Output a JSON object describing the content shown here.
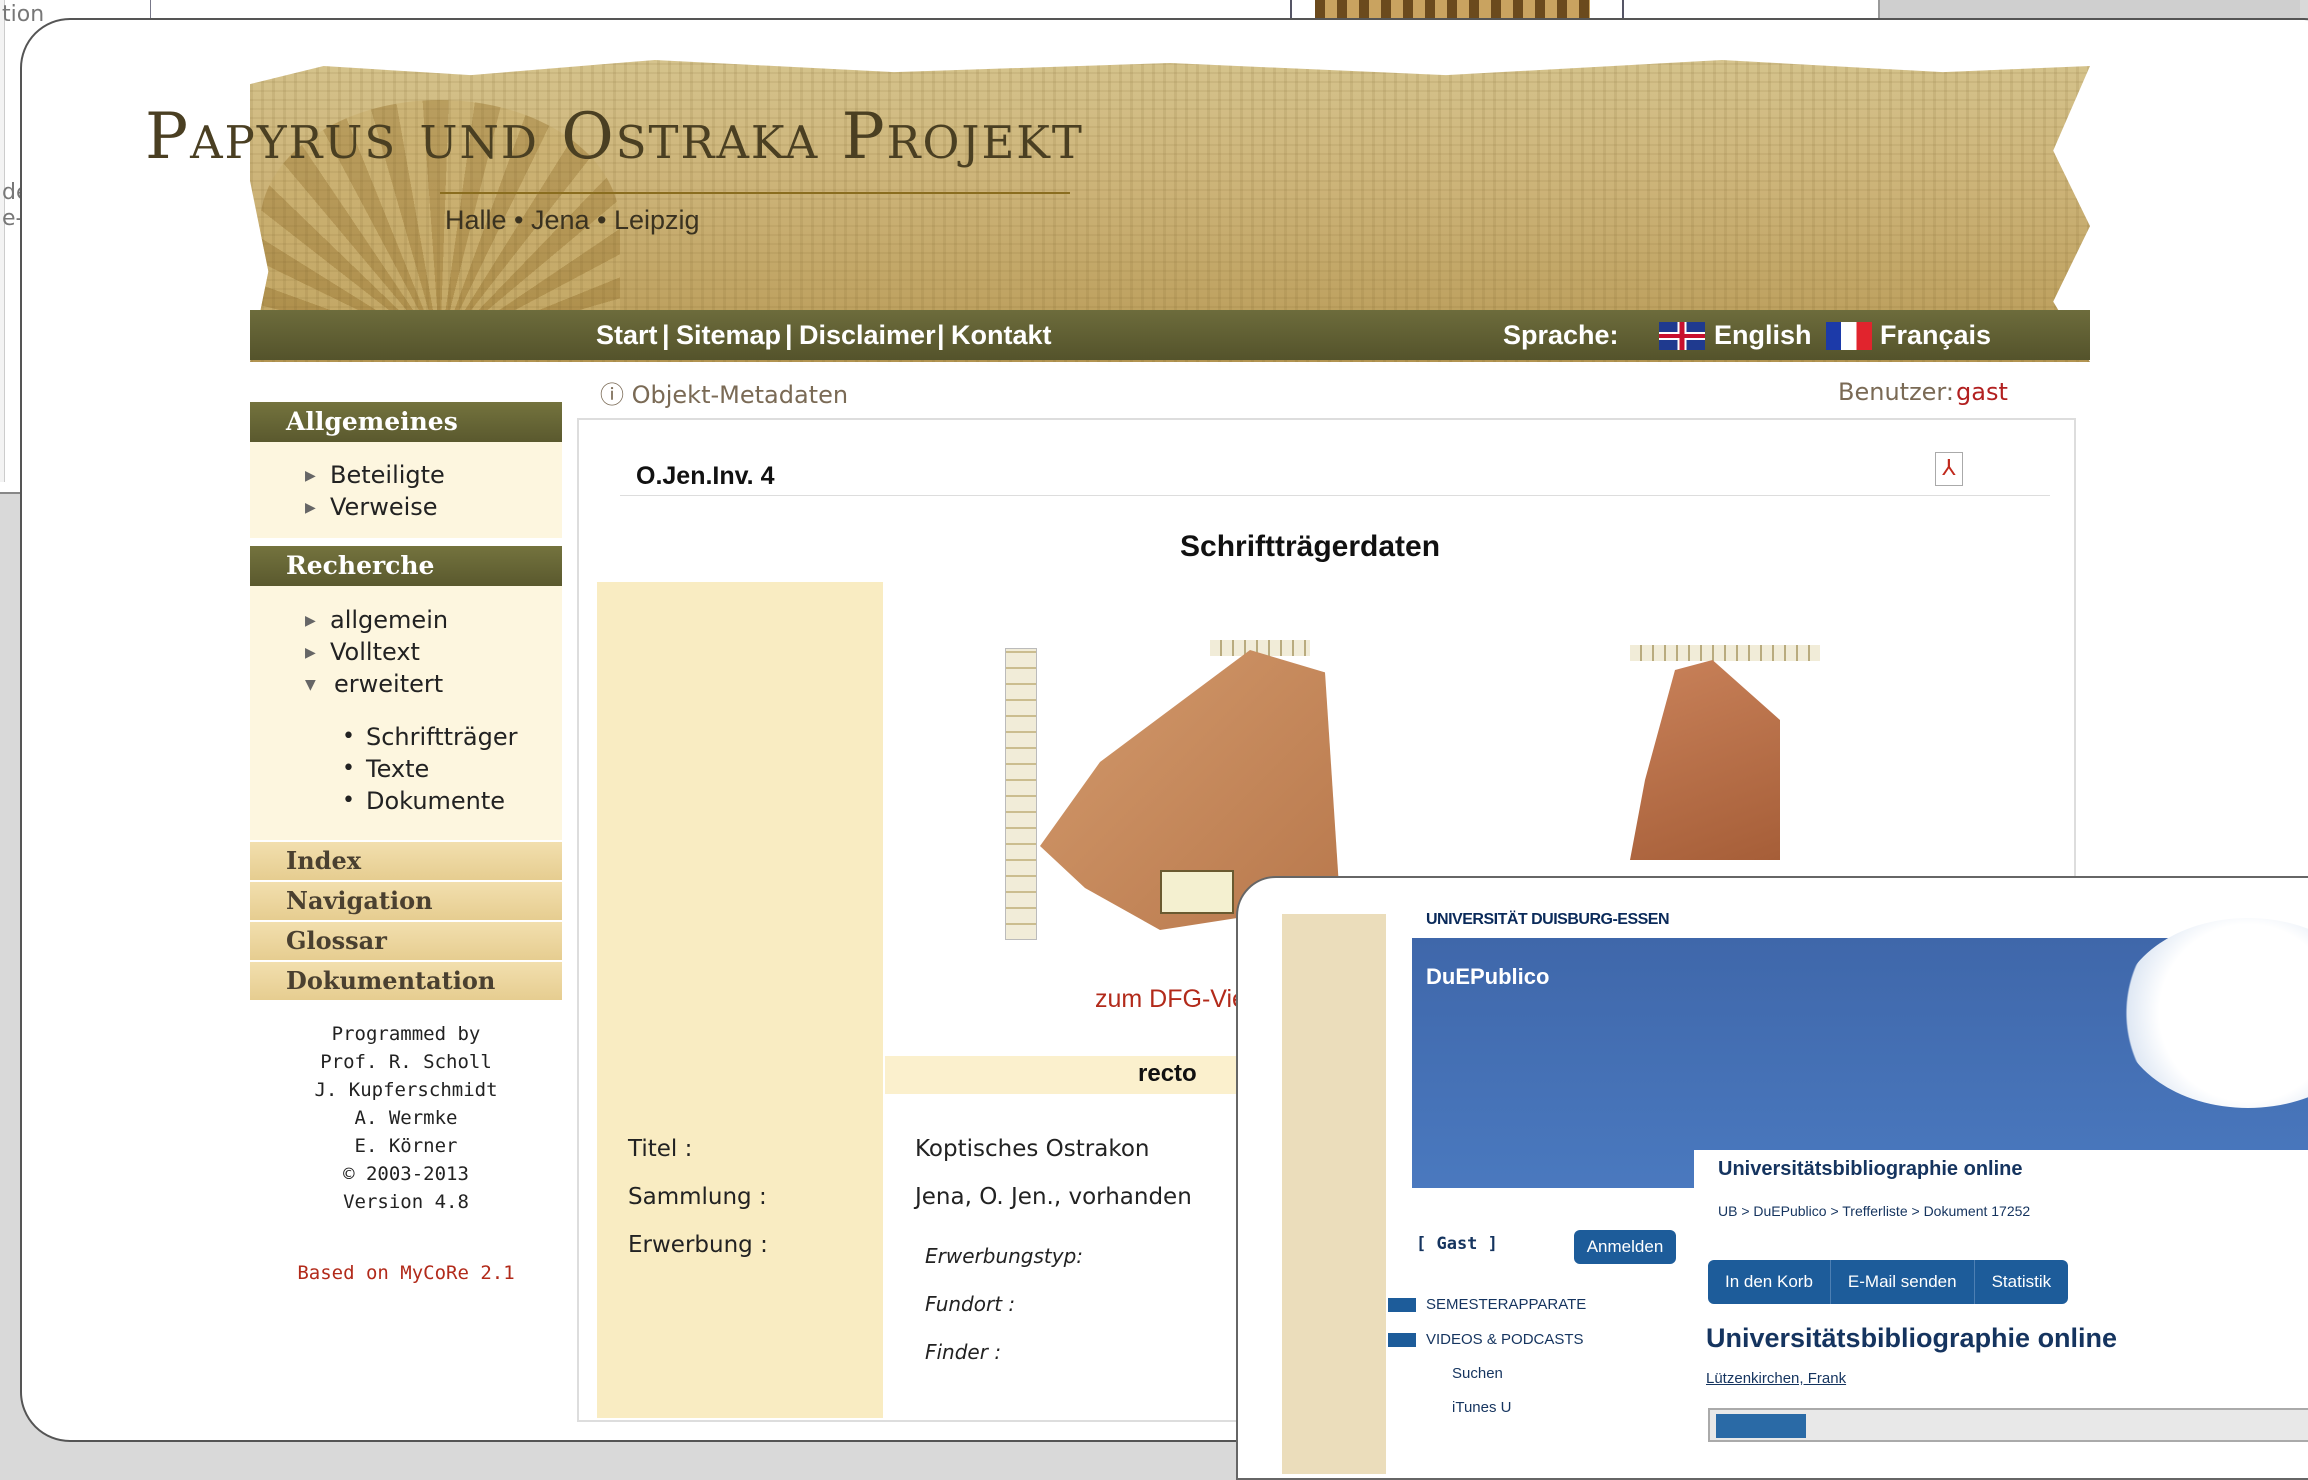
{
  "background": {
    "fragments": [
      "tion",
      "de",
      "e-V"
    ]
  },
  "header": {
    "title": "Papyrus und Ostraka Projekt",
    "subtitle": "Halle • Jena • Leipzig",
    "nav": [
      "Start",
      "|",
      "Sitemap",
      "|",
      "Disclaimer",
      "|",
      "Kontakt"
    ],
    "language_label": "Sprache:",
    "languages": [
      {
        "label": "English",
        "flag": "uk-flag-icon"
      },
      {
        "label": "Français",
        "flag": "fr-flag-icon"
      }
    ]
  },
  "sidebar": {
    "allgemeines": {
      "heading": "Allgemeines",
      "items": [
        "Beteiligte",
        "Verweise"
      ]
    },
    "recherche": {
      "heading": "Recherche",
      "items": [
        "allgemein",
        "Volltext",
        "erweitert"
      ],
      "subitems": [
        "Schriftträger",
        "Texte",
        "Dokumente"
      ]
    },
    "flat_items": [
      "Index",
      "Navigation",
      "Glossar",
      "Dokumentation"
    ],
    "credits": [
      "Programmed by",
      "Prof. R. Scholl",
      "J. Kupferschmidt",
      "A. Wermke",
      "E. Körner",
      "© 2003-2013",
      "Version 4.8"
    ],
    "based_on": "Based on MyCoRe 2.1"
  },
  "content": {
    "meta_link": "ⓘ Objekt-Metadaten",
    "user_label": "Benutzer:",
    "user_value": "gast",
    "object_id": "O.Jen.Inv. 4",
    "section_heading": "Schriftträgerdaten",
    "dfg_link": "zum DFG-Vie",
    "recto_label": "recto",
    "fields": [
      {
        "label": "Titel :",
        "value": "Koptisches Ostrakon"
      },
      {
        "label": "Sammlung :",
        "value": "Jena, O. Jen., vorhanden"
      },
      {
        "label": "Erwerbung :",
        "value": ""
      }
    ],
    "subfields": [
      "Erwerbungstyp:",
      "Fundort :",
      "Finder :"
    ]
  },
  "overlay": {
    "university": "UNIVERSITÄT DUISBURG-ESSEN",
    "brand": "DuEPublico",
    "section_title": "Universitätsbibliographie online",
    "breadcrumb": "UB  >  DuEPublico  >  Trefferliste  >  Dokument 17252",
    "guest": "[ Gast ]",
    "login": "Anmelden",
    "tabs": [
      "In den Korb",
      "E-Mail senden",
      "Statistik"
    ],
    "menu": [
      "SEMESTERAPPARATE",
      "VIDEOS & PODCASTS",
      "Suchen",
      "iTunes U"
    ],
    "heading": "Universitätsbibliographie online",
    "author": "Lützenkirchen, Frank"
  },
  "colors": {
    "nav_olive": "#5f5e31",
    "sidebar_cream": "#fdf6df",
    "beige_column": "#f9ecc2",
    "link_red": "#b22a1a",
    "ude_blue": "#1d5c9a"
  }
}
